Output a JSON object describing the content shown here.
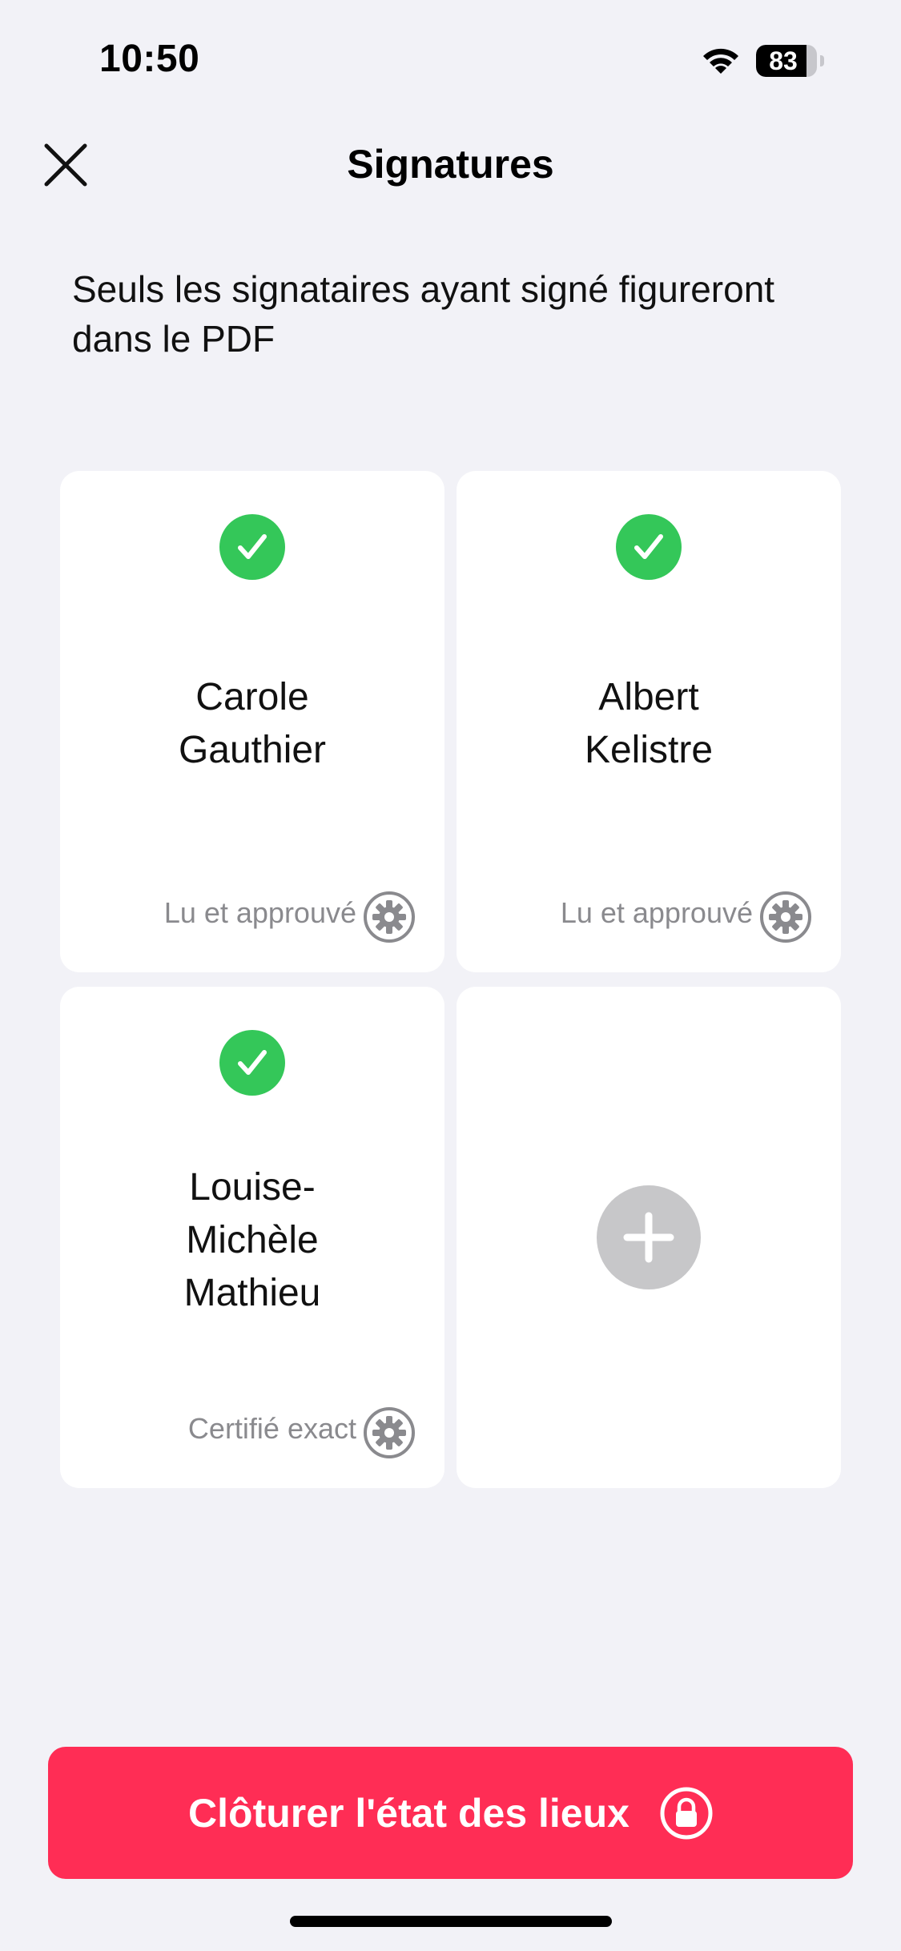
{
  "status_bar": {
    "time": "10:50",
    "battery_level": "83",
    "battery_fraction": 0.83,
    "wifi_icon": "wifi-icon"
  },
  "header": {
    "title": "Signatures",
    "close_icon": "close-icon"
  },
  "subtitle": "Seuls les signataires ayant signé figureront dans le PDF",
  "signers": [
    {
      "name": "Carole\nGauthier",
      "mention": "Lu et approuvé",
      "signed": true
    },
    {
      "name": "Albert\nKelistre",
      "mention": "Lu et approuvé",
      "signed": true
    },
    {
      "name": "Louise-\nMichèle\nMathieu",
      "mention": "Certifié exact",
      "signed": true
    }
  ],
  "add_signer_icon": "plus-icon",
  "footer": {
    "cta_label": "Clôturer l'état des lieux",
    "cta_icon": "lock-icon"
  },
  "colors": {
    "background": "#f2f2f7",
    "check_green": "#34c759",
    "cta_red": "#ff2d55",
    "muted_text": "#8a8a8e",
    "add_button_gray": "#c7c7c9"
  }
}
